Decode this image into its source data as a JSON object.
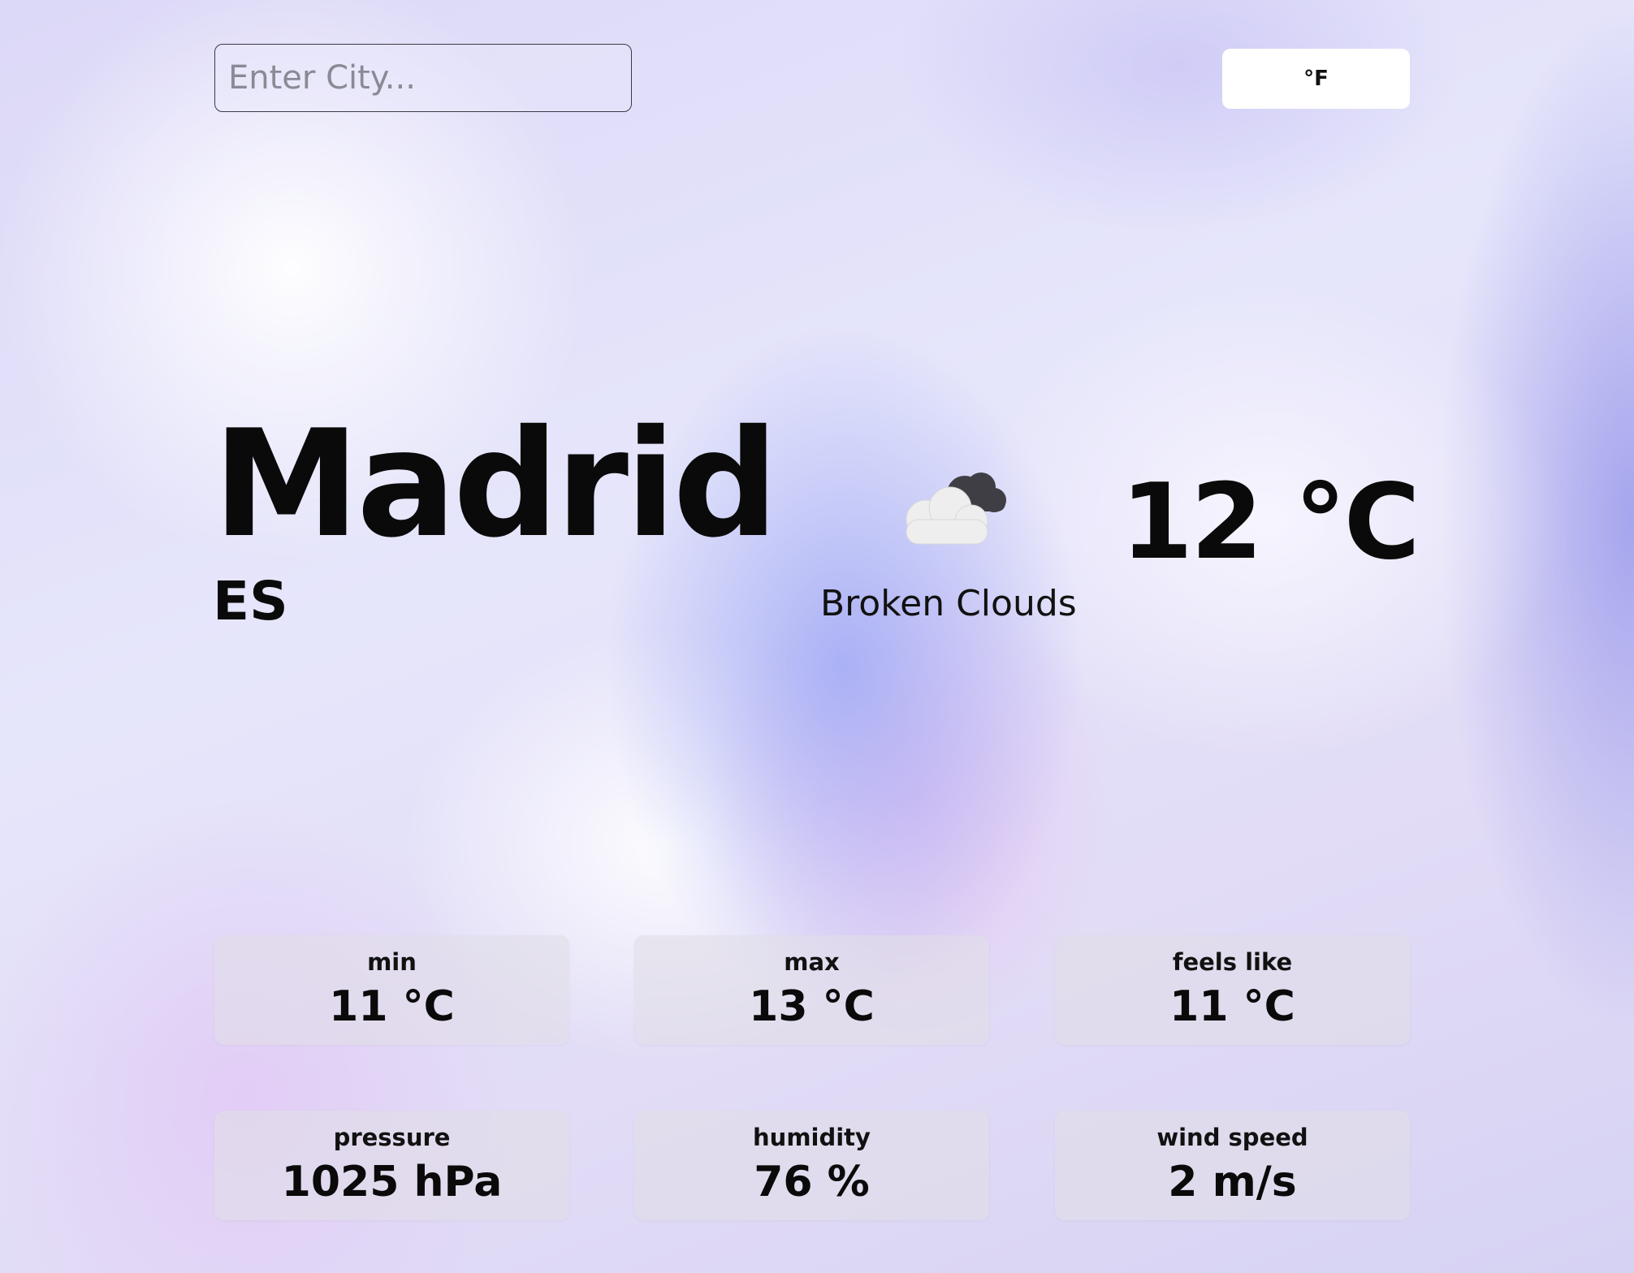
{
  "search": {
    "placeholder": "Enter City...",
    "value": ""
  },
  "unit_toggle": {
    "label": "°F"
  },
  "location": {
    "city": "Madrid",
    "country": "ES"
  },
  "current": {
    "icon": "broken-clouds-icon",
    "description": "Broken Clouds",
    "temperature": "12 °C"
  },
  "stats": [
    {
      "label": "min",
      "value": "11 °C"
    },
    {
      "label": "max",
      "value": "13 °C"
    },
    {
      "label": "feels like",
      "value": "11 °C"
    },
    {
      "label": "pressure",
      "value": "1025 hPa"
    },
    {
      "label": "humidity",
      "value": "76 %"
    },
    {
      "label": "wind speed",
      "value": "2 m/s"
    }
  ],
  "colors": {
    "background": "#e2e0f8",
    "text": "#0a0a0a",
    "card": "#e1dee8",
    "button": "#ffffff"
  }
}
